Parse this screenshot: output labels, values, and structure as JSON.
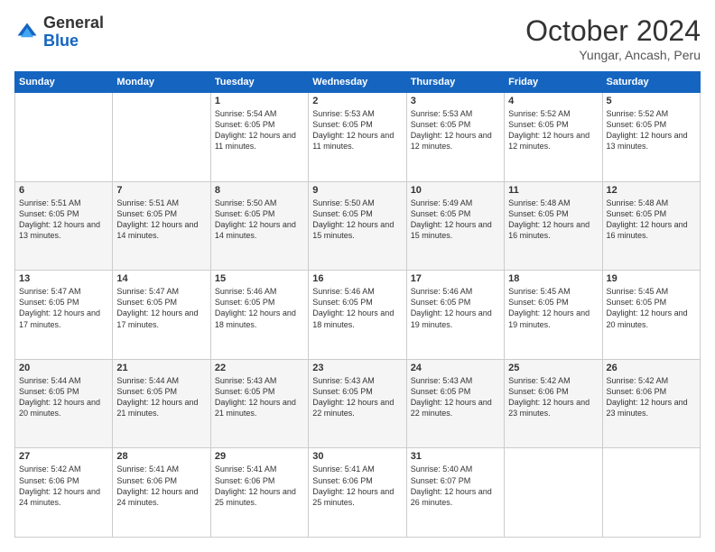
{
  "logo": {
    "general": "General",
    "blue": "Blue"
  },
  "header": {
    "month": "October 2024",
    "location": "Yungar, Ancash, Peru"
  },
  "weekdays": [
    "Sunday",
    "Monday",
    "Tuesday",
    "Wednesday",
    "Thursday",
    "Friday",
    "Saturday"
  ],
  "weeks": [
    [
      {
        "day": "",
        "sunrise": "",
        "sunset": "",
        "daylight": ""
      },
      {
        "day": "",
        "sunrise": "",
        "sunset": "",
        "daylight": ""
      },
      {
        "day": "1",
        "sunrise": "Sunrise: 5:54 AM",
        "sunset": "Sunset: 6:05 PM",
        "daylight": "Daylight: 12 hours and 11 minutes."
      },
      {
        "day": "2",
        "sunrise": "Sunrise: 5:53 AM",
        "sunset": "Sunset: 6:05 PM",
        "daylight": "Daylight: 12 hours and 11 minutes."
      },
      {
        "day": "3",
        "sunrise": "Sunrise: 5:53 AM",
        "sunset": "Sunset: 6:05 PM",
        "daylight": "Daylight: 12 hours and 12 minutes."
      },
      {
        "day": "4",
        "sunrise": "Sunrise: 5:52 AM",
        "sunset": "Sunset: 6:05 PM",
        "daylight": "Daylight: 12 hours and 12 minutes."
      },
      {
        "day": "5",
        "sunrise": "Sunrise: 5:52 AM",
        "sunset": "Sunset: 6:05 PM",
        "daylight": "Daylight: 12 hours and 13 minutes."
      }
    ],
    [
      {
        "day": "6",
        "sunrise": "Sunrise: 5:51 AM",
        "sunset": "Sunset: 6:05 PM",
        "daylight": "Daylight: 12 hours and 13 minutes."
      },
      {
        "day": "7",
        "sunrise": "Sunrise: 5:51 AM",
        "sunset": "Sunset: 6:05 PM",
        "daylight": "Daylight: 12 hours and 14 minutes."
      },
      {
        "day": "8",
        "sunrise": "Sunrise: 5:50 AM",
        "sunset": "Sunset: 6:05 PM",
        "daylight": "Daylight: 12 hours and 14 minutes."
      },
      {
        "day": "9",
        "sunrise": "Sunrise: 5:50 AM",
        "sunset": "Sunset: 6:05 PM",
        "daylight": "Daylight: 12 hours and 15 minutes."
      },
      {
        "day": "10",
        "sunrise": "Sunrise: 5:49 AM",
        "sunset": "Sunset: 6:05 PM",
        "daylight": "Daylight: 12 hours and 15 minutes."
      },
      {
        "day": "11",
        "sunrise": "Sunrise: 5:48 AM",
        "sunset": "Sunset: 6:05 PM",
        "daylight": "Daylight: 12 hours and 16 minutes."
      },
      {
        "day": "12",
        "sunrise": "Sunrise: 5:48 AM",
        "sunset": "Sunset: 6:05 PM",
        "daylight": "Daylight: 12 hours and 16 minutes."
      }
    ],
    [
      {
        "day": "13",
        "sunrise": "Sunrise: 5:47 AM",
        "sunset": "Sunset: 6:05 PM",
        "daylight": "Daylight: 12 hours and 17 minutes."
      },
      {
        "day": "14",
        "sunrise": "Sunrise: 5:47 AM",
        "sunset": "Sunset: 6:05 PM",
        "daylight": "Daylight: 12 hours and 17 minutes."
      },
      {
        "day": "15",
        "sunrise": "Sunrise: 5:46 AM",
        "sunset": "Sunset: 6:05 PM",
        "daylight": "Daylight: 12 hours and 18 minutes."
      },
      {
        "day": "16",
        "sunrise": "Sunrise: 5:46 AM",
        "sunset": "Sunset: 6:05 PM",
        "daylight": "Daylight: 12 hours and 18 minutes."
      },
      {
        "day": "17",
        "sunrise": "Sunrise: 5:46 AM",
        "sunset": "Sunset: 6:05 PM",
        "daylight": "Daylight: 12 hours and 19 minutes."
      },
      {
        "day": "18",
        "sunrise": "Sunrise: 5:45 AM",
        "sunset": "Sunset: 6:05 PM",
        "daylight": "Daylight: 12 hours and 19 minutes."
      },
      {
        "day": "19",
        "sunrise": "Sunrise: 5:45 AM",
        "sunset": "Sunset: 6:05 PM",
        "daylight": "Daylight: 12 hours and 20 minutes."
      }
    ],
    [
      {
        "day": "20",
        "sunrise": "Sunrise: 5:44 AM",
        "sunset": "Sunset: 6:05 PM",
        "daylight": "Daylight: 12 hours and 20 minutes."
      },
      {
        "day": "21",
        "sunrise": "Sunrise: 5:44 AM",
        "sunset": "Sunset: 6:05 PM",
        "daylight": "Daylight: 12 hours and 21 minutes."
      },
      {
        "day": "22",
        "sunrise": "Sunrise: 5:43 AM",
        "sunset": "Sunset: 6:05 PM",
        "daylight": "Daylight: 12 hours and 21 minutes."
      },
      {
        "day": "23",
        "sunrise": "Sunrise: 5:43 AM",
        "sunset": "Sunset: 6:05 PM",
        "daylight": "Daylight: 12 hours and 22 minutes."
      },
      {
        "day": "24",
        "sunrise": "Sunrise: 5:43 AM",
        "sunset": "Sunset: 6:05 PM",
        "daylight": "Daylight: 12 hours and 22 minutes."
      },
      {
        "day": "25",
        "sunrise": "Sunrise: 5:42 AM",
        "sunset": "Sunset: 6:06 PM",
        "daylight": "Daylight: 12 hours and 23 minutes."
      },
      {
        "day": "26",
        "sunrise": "Sunrise: 5:42 AM",
        "sunset": "Sunset: 6:06 PM",
        "daylight": "Daylight: 12 hours and 23 minutes."
      }
    ],
    [
      {
        "day": "27",
        "sunrise": "Sunrise: 5:42 AM",
        "sunset": "Sunset: 6:06 PM",
        "daylight": "Daylight: 12 hours and 24 minutes."
      },
      {
        "day": "28",
        "sunrise": "Sunrise: 5:41 AM",
        "sunset": "Sunset: 6:06 PM",
        "daylight": "Daylight: 12 hours and 24 minutes."
      },
      {
        "day": "29",
        "sunrise": "Sunrise: 5:41 AM",
        "sunset": "Sunset: 6:06 PM",
        "daylight": "Daylight: 12 hours and 25 minutes."
      },
      {
        "day": "30",
        "sunrise": "Sunrise: 5:41 AM",
        "sunset": "Sunset: 6:06 PM",
        "daylight": "Daylight: 12 hours and 25 minutes."
      },
      {
        "day": "31",
        "sunrise": "Sunrise: 5:40 AM",
        "sunset": "Sunset: 6:07 PM",
        "daylight": "Daylight: 12 hours and 26 minutes."
      },
      {
        "day": "",
        "sunrise": "",
        "sunset": "",
        "daylight": ""
      },
      {
        "day": "",
        "sunrise": "",
        "sunset": "",
        "daylight": ""
      }
    ]
  ]
}
